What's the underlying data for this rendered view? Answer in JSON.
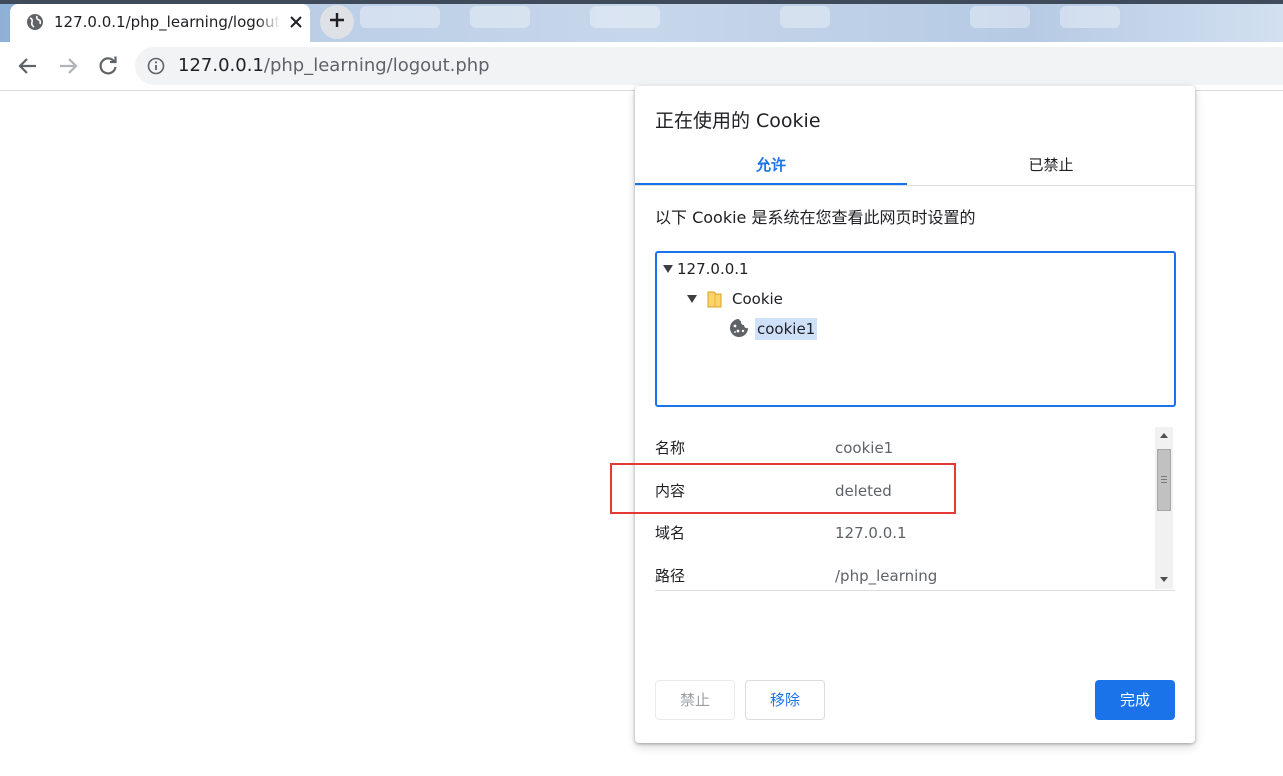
{
  "browser": {
    "tab_title": "127.0.0.1/php_learning/logout.php",
    "tab_icon": "globe-icon",
    "close_icon": "close-icon",
    "new_tab_icon": "plus-icon",
    "nav": {
      "back_icon": "back-arrow-icon",
      "forward_icon": "forward-arrow-icon",
      "reload_icon": "reload-icon"
    },
    "address": {
      "info_icon": "info-icon",
      "host": "127.0.0.1",
      "path": "/php_learning/logout.php"
    }
  },
  "dialog": {
    "title": "正在使用的 Cookie",
    "tabs": [
      {
        "label": "允许",
        "active": true
      },
      {
        "label": "已禁止",
        "active": false
      }
    ],
    "description": "以下 Cookie 是系统在您查看此网页时设置的",
    "tree": {
      "site": "127.0.0.1",
      "folder": "Cookie",
      "folder_icon": "folder-icon",
      "cookie": "cookie1",
      "cookie_icon": "cookie-icon"
    },
    "details": [
      {
        "key": "名称",
        "value": "cookie1"
      },
      {
        "key": "内容",
        "value": "deleted"
      },
      {
        "key": "域名",
        "value": "127.0.0.1"
      },
      {
        "key": "路径",
        "value": "/php_learning"
      }
    ],
    "buttons": {
      "block": "禁止",
      "remove": "移除",
      "done": "完成"
    }
  },
  "colors": {
    "accent": "#1a73e8",
    "highlight_box": "#e53935"
  }
}
